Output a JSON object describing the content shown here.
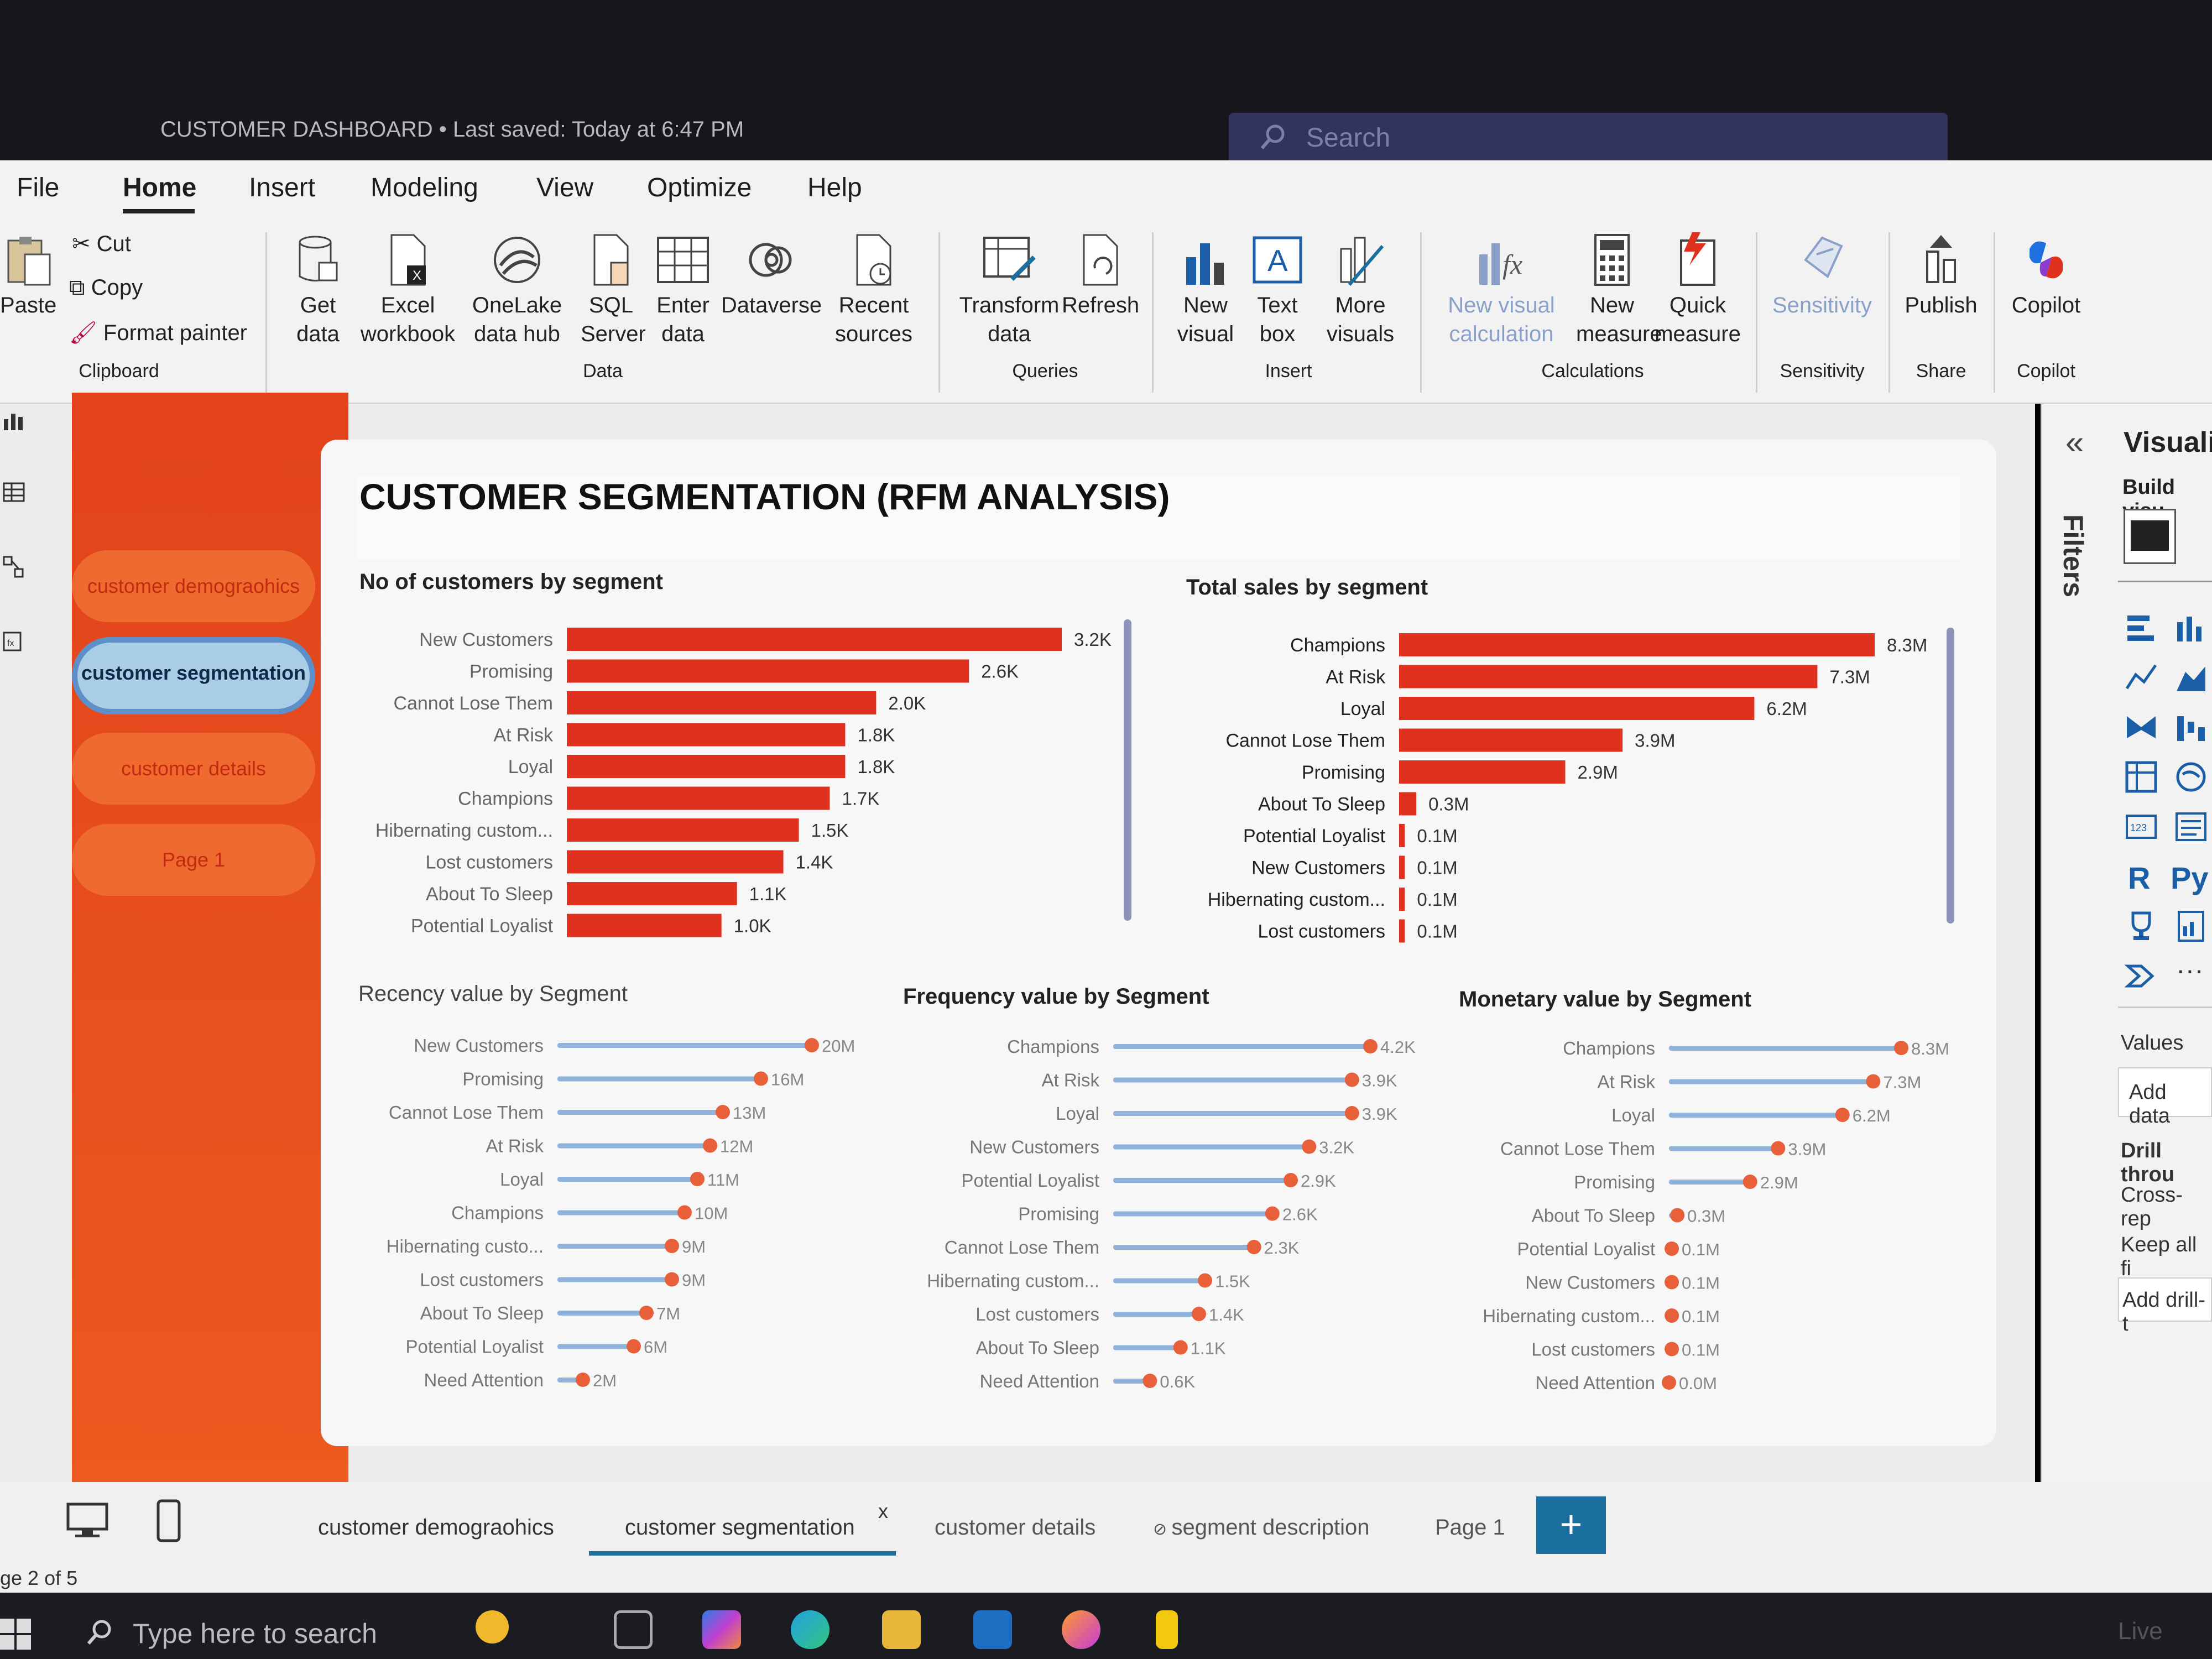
{
  "titlebar": {
    "doc_title": "CUSTOMER DASHBOARD • Last saved: Today at 6:47 PM",
    "search_placeholder": "Search"
  },
  "menu": {
    "items": [
      "File",
      "Home",
      "Insert",
      "Modeling",
      "View",
      "Optimize",
      "Help"
    ],
    "active": "Home"
  },
  "ribbon": {
    "clipboard": {
      "paste": "Paste",
      "cut": "Cut",
      "copy": "Copy",
      "format_painter": "Format painter",
      "group": "Clipboard"
    },
    "data": {
      "get_data": "Get data",
      "excel": "Excel workbook",
      "onelake": "OneLake data hub",
      "sql": "SQL Server",
      "enter": "Enter data",
      "dataverse": "Dataverse",
      "recent": "Recent sources",
      "group": "Data"
    },
    "queries": {
      "transform": "Transform data",
      "refresh": "Refresh",
      "group": "Queries"
    },
    "insert": {
      "new_visual": "New visual",
      "text_box": "Text box",
      "more_visuals": "More visuals",
      "group": "Insert"
    },
    "calculations": {
      "new_visual_calc": "New visual calculation",
      "new_measure": "New measure",
      "quick_measure": "Quick measure",
      "group": "Calculations"
    },
    "sensitivity": {
      "label": "Sensitivity",
      "group": "Sensitivity"
    },
    "share": {
      "publish": "Publish",
      "group": "Share"
    },
    "copilot": {
      "label": "Copilot",
      "group": "Copilot"
    }
  },
  "nav": {
    "buttons": [
      "customer demograohics",
      "customer segmentation",
      "customer details",
      "Page 1"
    ],
    "active": "customer segmentation"
  },
  "report": {
    "title": "CUSTOMER SEGMENTATION (RFM ANALYSIS)"
  },
  "colors": {
    "bar": "#e0301e",
    "lollipop_line": "#8fb4dc",
    "lollipop_dot": "#e8603a",
    "nav_panel": "#e2421c",
    "accent": "#1b6f9e"
  },
  "chart_data": [
    {
      "type": "bar",
      "title": "No of customers by segment",
      "categories": [
        "New Customers",
        "Promising",
        "Cannot Lose Them",
        "At Risk",
        "Loyal",
        "Champions",
        "Hibernating custom...",
        "Lost customers",
        "About To Sleep",
        "Potential Loyalist"
      ],
      "values": [
        3200,
        2600,
        2000,
        1800,
        1800,
        1700,
        1500,
        1400,
        1100,
        1000
      ],
      "labels": [
        "3.2K",
        "2.6K",
        "2.0K",
        "1.8K",
        "1.8K",
        "1.7K",
        "1.5K",
        "1.4K",
        "1.1K",
        "1.0K"
      ],
      "xlim": [
        0,
        3200
      ]
    },
    {
      "type": "bar",
      "title": "Total sales by segment",
      "categories": [
        "Champions",
        "At Risk",
        "Loyal",
        "Cannot Lose Them",
        "Promising",
        "About To Sleep",
        "Potential Loyalist",
        "New Customers",
        "Hibernating custom...",
        "Lost customers"
      ],
      "values": [
        8.3,
        7.3,
        6.2,
        3.9,
        2.9,
        0.3,
        0.1,
        0.1,
        0.1,
        0.1
      ],
      "labels": [
        "8.3M",
        "7.3M",
        "6.2M",
        "3.9M",
        "2.9M",
        "0.3M",
        "0.1M",
        "0.1M",
        "0.1M",
        "0.1M"
      ],
      "xlim": [
        0,
        8.3
      ]
    },
    {
      "type": "lollipop",
      "title": "Recency value by Segment",
      "categories": [
        "New Customers",
        "Promising",
        "Cannot Lose Them",
        "At Risk",
        "Loyal",
        "Champions",
        "Hibernating custo...",
        "Lost customers",
        "About To Sleep",
        "Potential Loyalist",
        "Need Attention"
      ],
      "values": [
        20,
        16,
        13,
        12,
        11,
        10,
        9,
        9,
        7,
        6,
        2
      ],
      "labels": [
        "20M",
        "16M",
        "13M",
        "12M",
        "11M",
        "10M",
        "9M",
        "9M",
        "7M",
        "6M",
        "2M"
      ],
      "xlim": [
        0,
        20
      ]
    },
    {
      "type": "lollipop",
      "title": "Frequency value by Segment",
      "categories": [
        "Champions",
        "At Risk",
        "Loyal",
        "New Customers",
        "Potential Loyalist",
        "Promising",
        "Cannot Lose Them",
        "Hibernating custom...",
        "Lost customers",
        "About To Sleep",
        "Need Attention"
      ],
      "values": [
        4.2,
        3.9,
        3.9,
        3.2,
        2.9,
        2.6,
        2.3,
        1.5,
        1.4,
        1.1,
        0.6
      ],
      "labels": [
        "4.2K",
        "3.9K",
        "3.9K",
        "3.2K",
        "2.9K",
        "2.6K",
        "2.3K",
        "1.5K",
        "1.4K",
        "1.1K",
        "0.6K"
      ],
      "xlim": [
        0,
        4.2
      ]
    },
    {
      "type": "lollipop",
      "title": "Monetary value by Segment",
      "categories": [
        "Champions",
        "At Risk",
        "Loyal",
        "Cannot Lose Them",
        "Promising",
        "About To Sleep",
        "Potential Loyalist",
        "New Customers",
        "Hibernating custom...",
        "Lost customers",
        "Need Attention"
      ],
      "values": [
        8.3,
        7.3,
        6.2,
        3.9,
        2.9,
        0.3,
        0.1,
        0.1,
        0.1,
        0.1,
        0.0
      ],
      "labels": [
        "8.3M",
        "7.3M",
        "6.2M",
        "3.9M",
        "2.9M",
        "0.3M",
        "0.1M",
        "0.1M",
        "0.1M",
        "0.1M",
        "0.0M"
      ],
      "xlim": [
        0,
        8.3
      ]
    }
  ],
  "right_pane": {
    "filters": "Filters",
    "title": "Visualiz",
    "build": "Build visu",
    "values": "Values",
    "add_data": "Add data",
    "drill": "Drill throu",
    "cross_report": "Cross-rep",
    "keep_all": "Keep all fi",
    "add_drill": "Add drill-t"
  },
  "tabs": {
    "pages": [
      "customer demograohics",
      "customer segmentation",
      "customer details",
      "segment description",
      "Page 1"
    ],
    "active": "customer segmentation",
    "close": "x",
    "add": "+"
  },
  "status": {
    "page_indicator": "ge 2 of 5"
  },
  "taskbar": {
    "search_placeholder": "Type here to search",
    "live": "Live"
  }
}
